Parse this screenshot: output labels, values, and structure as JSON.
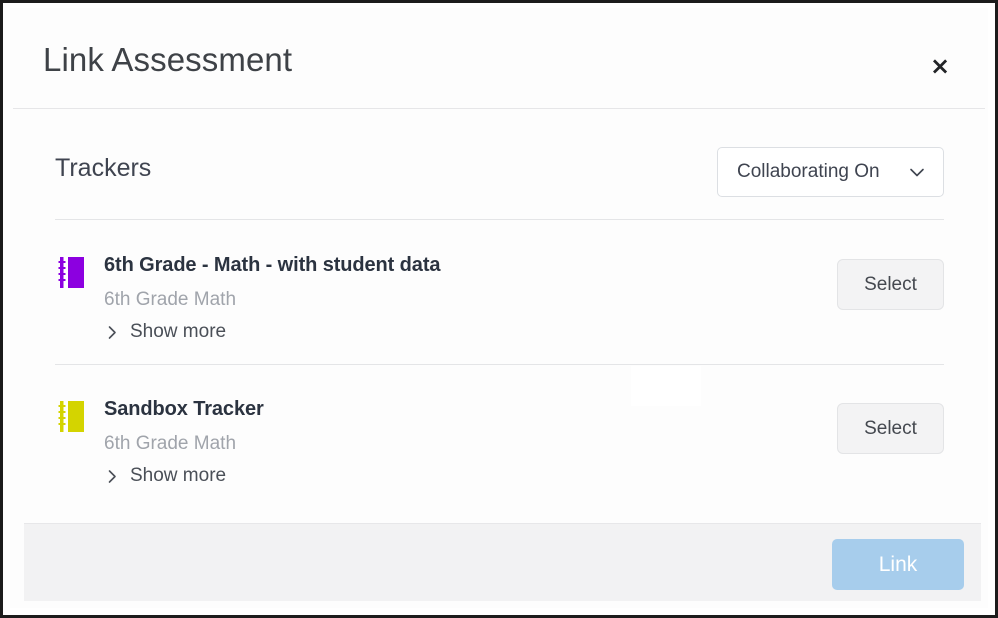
{
  "dialog": {
    "title": "Link Assessment",
    "close_label": "×"
  },
  "body": {
    "section_title": "Trackers",
    "filter": {
      "selected": "Collaborating On",
      "options": [
        "Collaborating On"
      ]
    },
    "trackers": [
      {
        "title": "6th Grade - Math - with student data",
        "subtitle": "6th Grade Math",
        "show_more_label": "Show more",
        "select_label": "Select",
        "icon": "notebook-icon",
        "icon_color": "#8c00e0"
      },
      {
        "title": "Sandbox Tracker",
        "subtitle": "6th Grade Math",
        "show_more_label": "Show more",
        "select_label": "Select",
        "icon": "notebook-icon",
        "icon_color": "#d4d400"
      }
    ]
  },
  "footer": {
    "primary_label": "Link",
    "primary_color": "#a7cdec"
  }
}
